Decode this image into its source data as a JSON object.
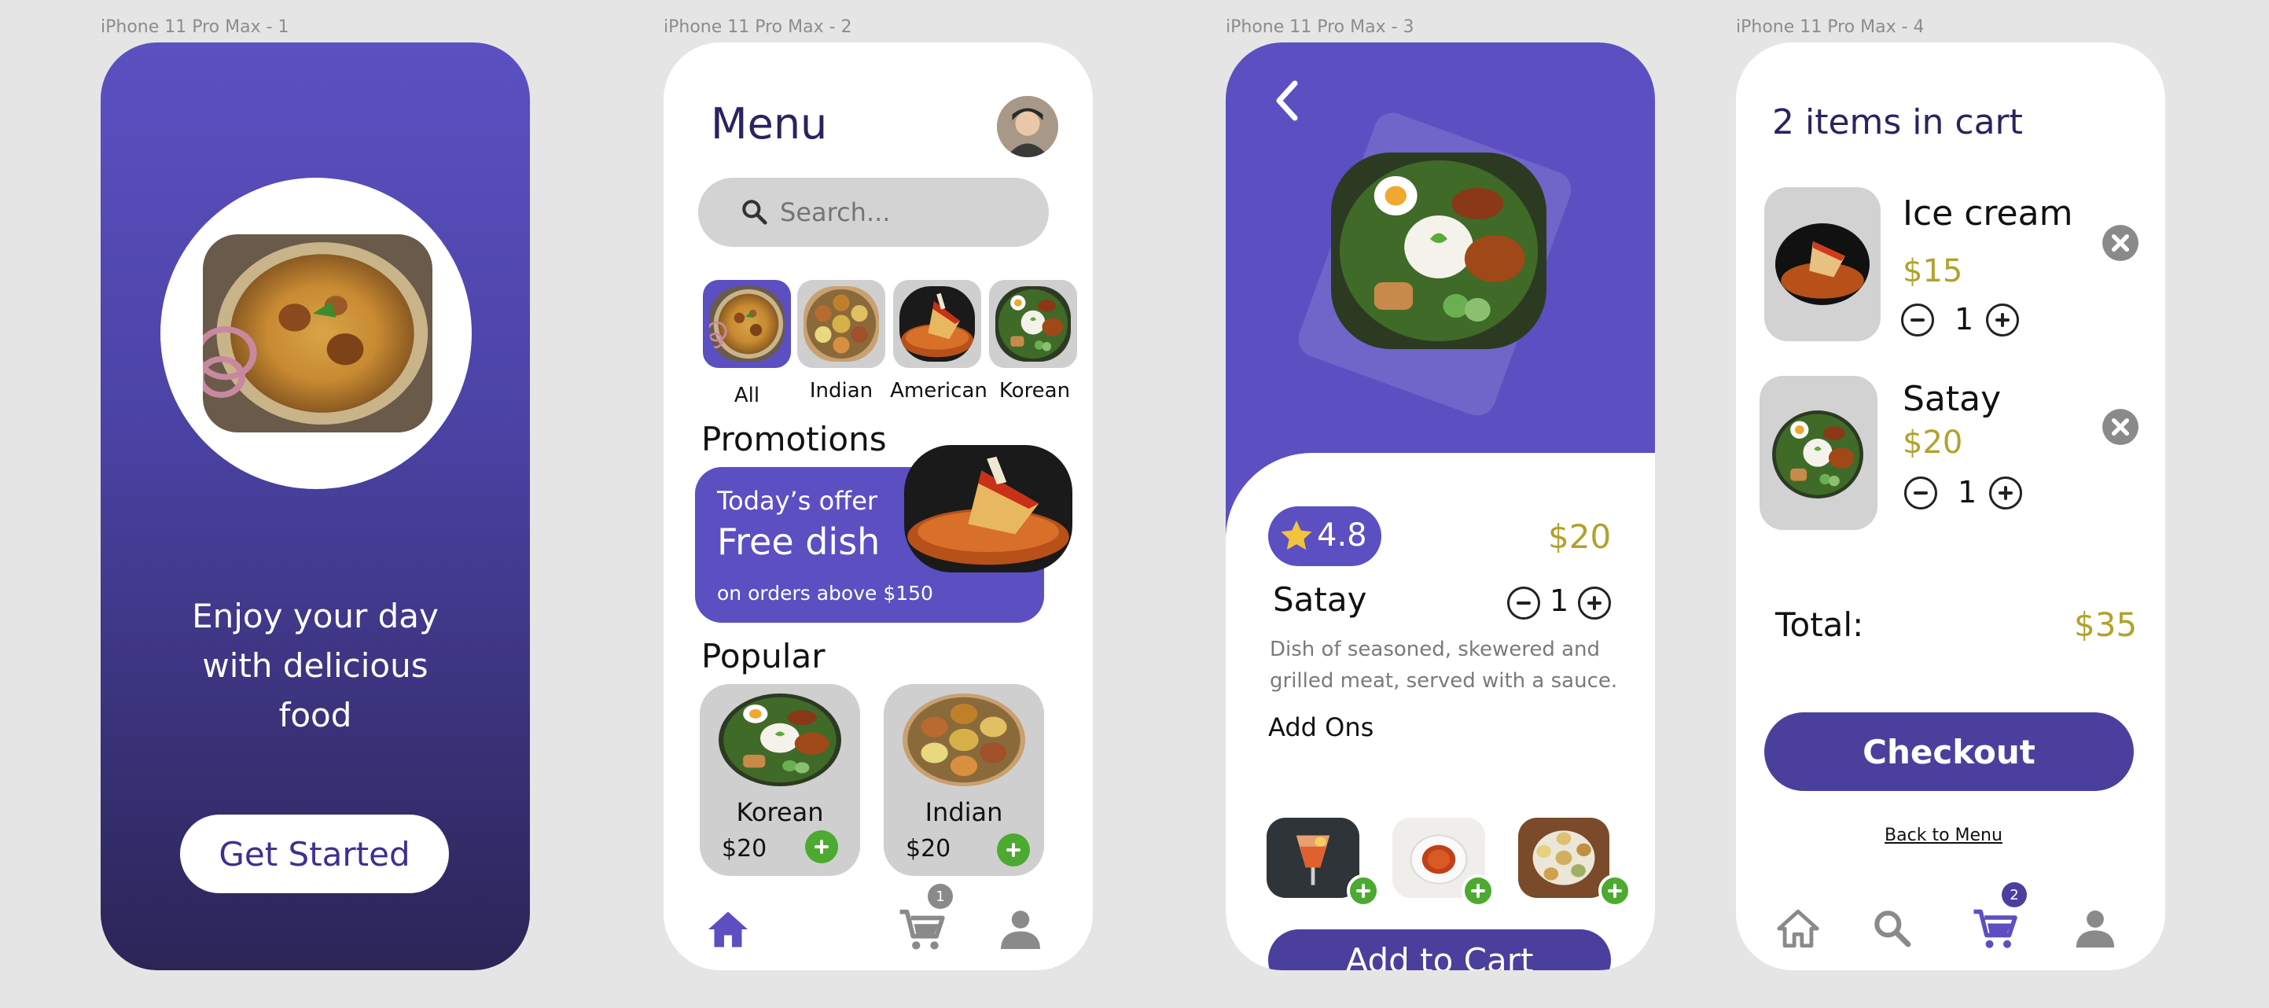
{
  "frames": {
    "f1": "iPhone 11 Pro Max - 1",
    "f2": "iPhone 11 Pro Max - 2",
    "f3": "iPhone 11 Pro Max - 3",
    "f4": "iPhone 11 Pro Max - 4"
  },
  "splash": {
    "tagline_1": "Enjoy your day",
    "tagline_2": "with delicious",
    "tagline_3": "food",
    "cta": "Get Started"
  },
  "menu": {
    "title": "Menu",
    "search_placeholder": "Search...",
    "categories": [
      "All",
      "Indian",
      "American",
      "Korean"
    ],
    "promotions_title": "Promotions",
    "promo": {
      "kicker": "Today’s offer",
      "headline": "Free dish",
      "note": "on orders above $150"
    },
    "popular_title": "Popular",
    "popular": [
      {
        "name": "Korean",
        "price": "$20"
      },
      {
        "name": "Indian",
        "price": "$20"
      }
    ],
    "cart_badge": "1"
  },
  "detail": {
    "rating": "4.8",
    "price": "$20",
    "name": "Satay",
    "qty": "1",
    "desc_1": "Dish of seasoned, skewered and",
    "desc_2": "grilled meat, served with a sauce.",
    "addons_title": "Add Ons",
    "cta": "Add to Cart"
  },
  "cart": {
    "title": "2 items in cart",
    "items": [
      {
        "name": "Ice cream",
        "price": "$15",
        "qty": "1"
      },
      {
        "name": "Satay",
        "price": "$20",
        "qty": "1"
      }
    ],
    "total_label": "Total:",
    "total_value": "$35",
    "checkout": "Checkout",
    "back": "Back to Menu",
    "cart_badge": "2"
  },
  "colors": {
    "brand": "#5b4fc2",
    "brand_dark": "#423a94",
    "gold": "#b2a22c",
    "add_green": "#4caa30"
  }
}
